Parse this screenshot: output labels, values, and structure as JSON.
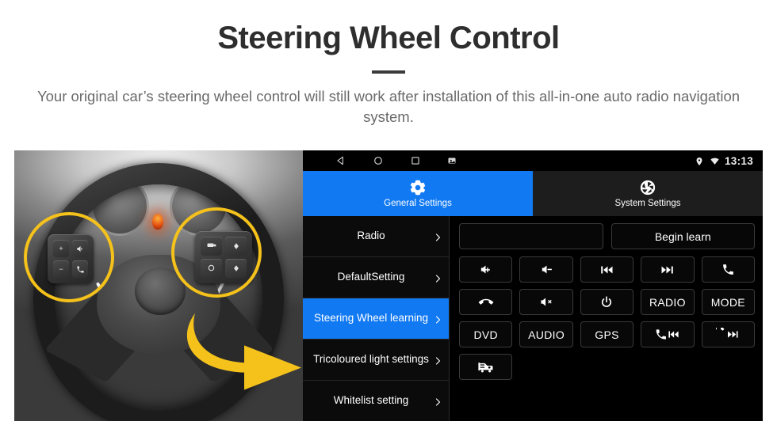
{
  "header": {
    "title": "Steering Wheel Control",
    "subtitle": "Your original car’s steering wheel control will still work after installation of this all-in-one auto radio navigation system."
  },
  "colors": {
    "accent_blue": "#1179f2",
    "highlight_yellow": "#f5c21b",
    "panel_black": "#000000",
    "tab_inactive": "#1d1d1d"
  },
  "photo": {
    "alt": "Car steering wheel with control button clusters highlighted",
    "highlight_left": "left-button-cluster",
    "highlight_right": "right-button-cluster",
    "arrow": "yellow-curved-arrow-pointing-right"
  },
  "statusbar": {
    "nav": [
      {
        "name": "back-icon"
      },
      {
        "name": "home-icon"
      },
      {
        "name": "recents-icon"
      },
      {
        "name": "screenshot-icon"
      }
    ],
    "status": [
      {
        "name": "location-icon"
      },
      {
        "name": "wifi-icon"
      }
    ],
    "time": "13:13"
  },
  "tabs": [
    {
      "label": "General Settings",
      "icon": "gear-icon",
      "active": true
    },
    {
      "label": "System Settings",
      "icon": "aperture-icon",
      "active": false
    }
  ],
  "sidebar": {
    "items": [
      {
        "label": "Radio",
        "selected": false
      },
      {
        "label": "DefaultSetting",
        "selected": false
      },
      {
        "label": "Steering Wheel learning",
        "selected": true
      },
      {
        "label": "Tricoloured light settings",
        "selected": false
      },
      {
        "label": "Whitelist setting",
        "selected": false
      }
    ]
  },
  "pane": {
    "display_value": "",
    "display_placeholder": "",
    "begin_button": "Begin learn",
    "buttons": [
      {
        "id": "vol-up",
        "label": "",
        "icon": "volume-up-icon"
      },
      {
        "id": "vol-down",
        "label": "",
        "icon": "volume-down-icon"
      },
      {
        "id": "prev-track",
        "label": "",
        "icon": "previous-track-icon"
      },
      {
        "id": "next-track",
        "label": "",
        "icon": "next-track-icon"
      },
      {
        "id": "call-answer",
        "label": "",
        "icon": "phone-icon"
      },
      {
        "id": "call-hangup",
        "label": "",
        "icon": "hangup-icon"
      },
      {
        "id": "mute",
        "label": "",
        "icon": "mute-icon"
      },
      {
        "id": "power",
        "label": "",
        "icon": "power-icon"
      },
      {
        "id": "radio",
        "label": "RADIO",
        "icon": ""
      },
      {
        "id": "mode",
        "label": "MODE",
        "icon": ""
      },
      {
        "id": "dvd",
        "label": "DVD",
        "icon": ""
      },
      {
        "id": "audio",
        "label": "AUDIO",
        "icon": ""
      },
      {
        "id": "gps",
        "label": "GPS",
        "icon": ""
      },
      {
        "id": "phone-prev",
        "label": "",
        "icon": "phone-prev-icon"
      },
      {
        "id": "hangup-next",
        "label": "",
        "icon": "hangup-next-icon"
      },
      {
        "id": "navigation",
        "label": "",
        "icon": "car-navigation-icon"
      }
    ]
  }
}
